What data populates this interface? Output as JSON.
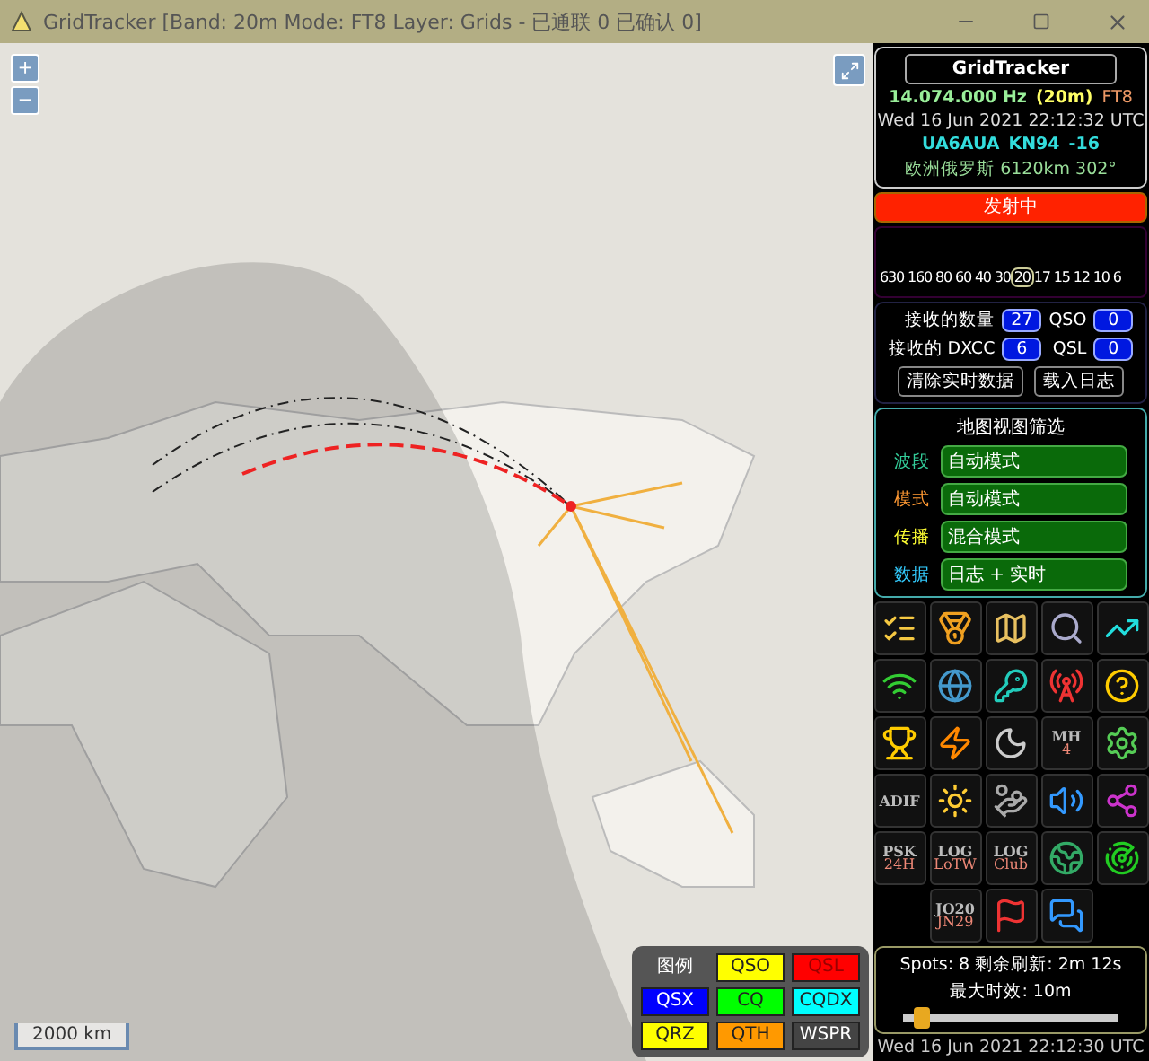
{
  "window": {
    "title": "GridTracker [Band: 20m Mode: FT8 Layer: Grids - 已通联 0 已确认 0]"
  },
  "map": {
    "zoom_in": "+",
    "zoom_out": "−",
    "scale": "2000 km",
    "legend": {
      "title": "图例",
      "items": [
        {
          "label": "QSO",
          "color": "#ffff00"
        },
        {
          "label": "QSL",
          "color": "#ff0000"
        },
        {
          "label": "QSX",
          "color": "#0000ff"
        },
        {
          "label": "CQ",
          "color": "#00ff00"
        },
        {
          "label": "CQDX",
          "color": "#00ffff"
        },
        {
          "label": "QRZ",
          "color": "#ffff00"
        },
        {
          "label": "QTH",
          "color": "#ff9900"
        },
        {
          "label": "WSPR",
          "color": "#444444"
        }
      ]
    }
  },
  "panel": {
    "app_name": "GridTracker",
    "frequency": "14.074.000 Hz",
    "band": "(20m)",
    "mode": "FT8",
    "datetime": "Wed 16 Jun 2021 22:12:32 UTC",
    "call": "UA6AUA",
    "grid": "KN94",
    "snr": "-16",
    "location": "欧洲俄罗斯 6120km 302°",
    "transmitting": {
      "label": "发射中",
      "on": true
    },
    "bands": [
      {
        "label": "630",
        "selected": false
      },
      {
        "label": "160",
        "selected": false
      },
      {
        "label": "80",
        "selected": false
      },
      {
        "label": "60",
        "selected": false
      },
      {
        "label": "40",
        "selected": false
      },
      {
        "label": "30",
        "selected": false
      },
      {
        "label": "20",
        "selected": true
      },
      {
        "label": "17",
        "selected": false
      },
      {
        "label": "15",
        "selected": false
      },
      {
        "label": "12",
        "selected": false
      },
      {
        "label": "10",
        "selected": false
      },
      {
        "label": "6",
        "selected": false
      }
    ],
    "stats": [
      {
        "label": "接收的数量",
        "value": "27"
      },
      {
        "label": "QSO",
        "value": "0"
      },
      {
        "label": "接收的 DXCC",
        "value": "6"
      },
      {
        "label": "QSL",
        "value": "0"
      }
    ],
    "buttons": [
      "清除实时数据",
      "载入日志"
    ],
    "filter": {
      "title": "地图视图筛选",
      "rows": [
        {
          "label": "波段",
          "value": "自动模式",
          "color": "#33cc99"
        },
        {
          "label": "模式",
          "value": "自动模式",
          "color": "#ff9933"
        },
        {
          "label": "传播",
          "value": "混合模式",
          "color": "#ffff33"
        },
        {
          "label": "数据",
          "value": "日志 + 实时",
          "color": "#33ccff"
        }
      ]
    },
    "tools": [
      {
        "kind": "checklist"
      },
      {
        "kind": "medal"
      },
      {
        "kind": "map"
      },
      {
        "kind": "search"
      },
      {
        "kind": "chart"
      },
      {
        "kind": "wifi"
      },
      {
        "kind": "globe"
      },
      {
        "kind": "key"
      },
      {
        "kind": "signal"
      },
      {
        "kind": "help"
      },
      {
        "kind": "trophy"
      },
      {
        "kind": "bolt"
      },
      {
        "kind": "moon"
      },
      {
        "kind": "text",
        "label": "MH",
        "sub": "4"
      },
      {
        "kind": "gears"
      },
      {
        "kind": "text",
        "label": "ADIF"
      },
      {
        "kind": "sun"
      },
      {
        "kind": "donate"
      },
      {
        "kind": "speaker"
      },
      {
        "kind": "network"
      },
      {
        "kind": "text",
        "label": "PSK",
        "sub": "24H"
      },
      {
        "kind": "text",
        "label": "LOG",
        "sub": "LoTW"
      },
      {
        "kind": "text",
        "label": "LOG",
        "sub": "Club"
      },
      {
        "kind": "web"
      },
      {
        "kind": "radar"
      },
      {
        "kind": "blank"
      },
      {
        "kind": "text",
        "label": "JO20",
        "sub": "JN29"
      },
      {
        "kind": "flag"
      },
      {
        "kind": "chat"
      },
      {
        "kind": "blank"
      }
    ],
    "spots": "Spots: 8 剩余刷新: 2m 12s",
    "max_age": "最大时效: 10m",
    "age_slider": {
      "level": 0.08
    },
    "footer_time": "Wed 16 Jun 2021 22:12:30 UTC"
  }
}
